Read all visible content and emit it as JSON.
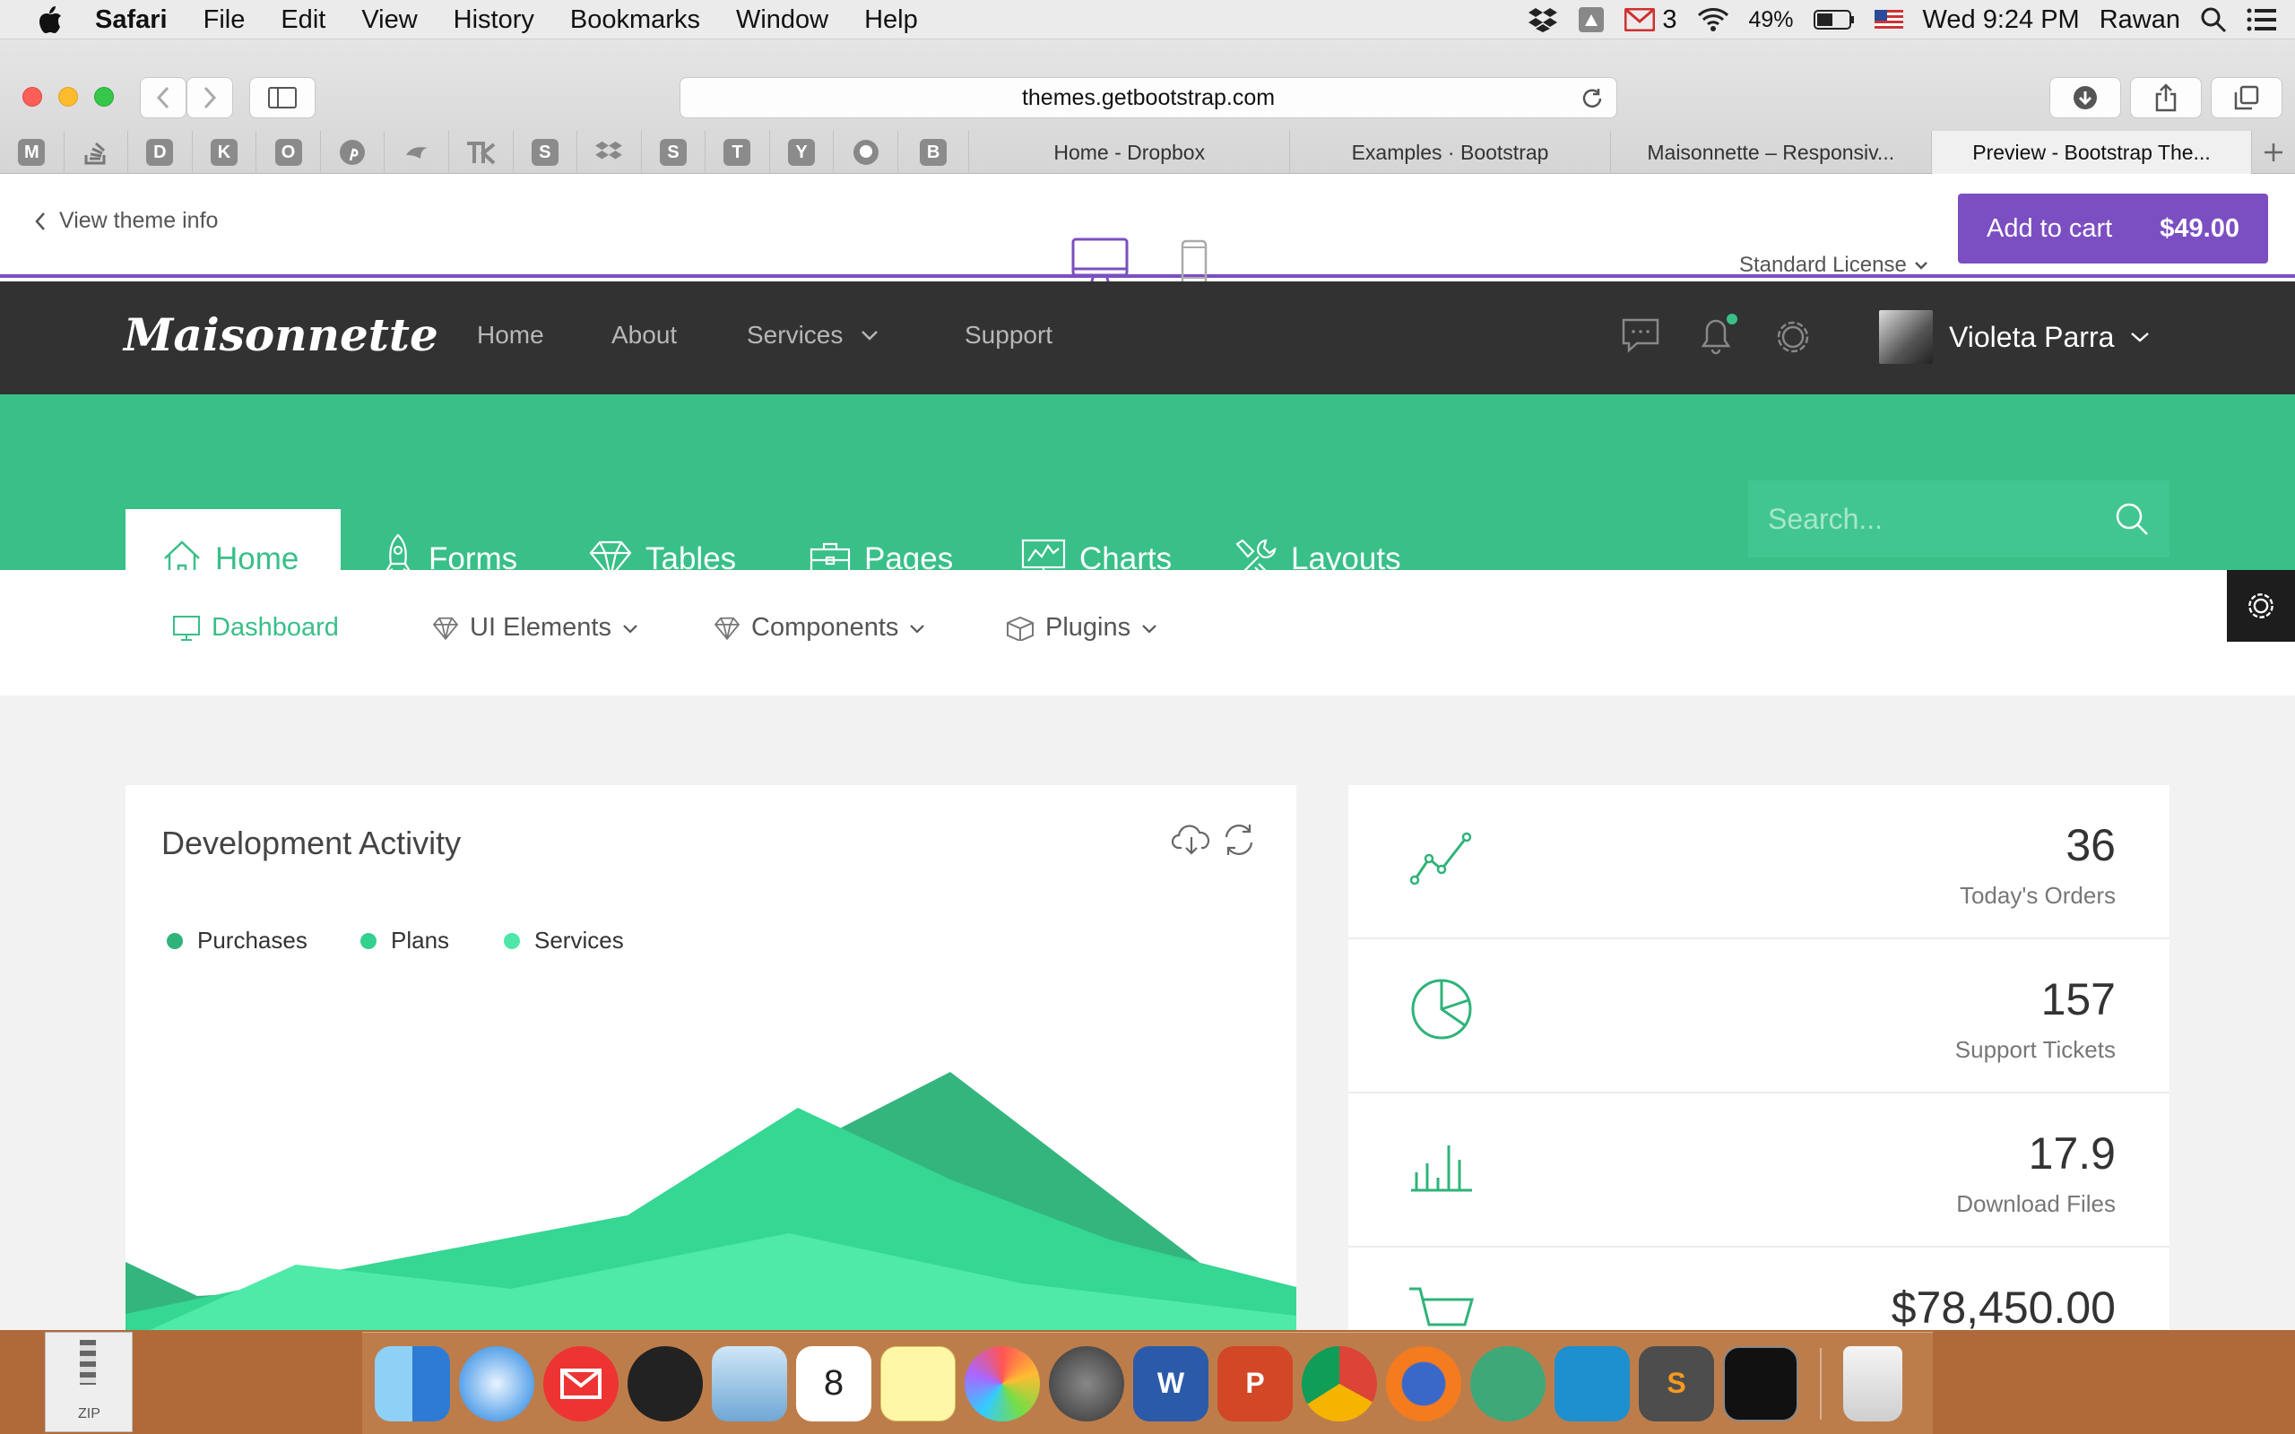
{
  "menubar": {
    "app_name": "Safari",
    "items": [
      "File",
      "Edit",
      "View",
      "History",
      "Bookmarks",
      "Window",
      "Help"
    ],
    "mail_count": "3",
    "battery": "49%",
    "clock": "Wed 9:24 PM",
    "user": "Rawan"
  },
  "browser": {
    "url": "themes.getbootstrap.com",
    "bookmarks": [
      "M",
      "",
      "D",
      "K",
      "O",
      "",
      "",
      "",
      "S",
      "",
      "S",
      "T",
      "Y",
      "",
      "B"
    ],
    "tabs": [
      "Home - Dropbox",
      "Examples · Bootstrap",
      "Maisonnette – Responsiv...",
      "Preview - Bootstrap The..."
    ]
  },
  "preview": {
    "view_theme": "View theme info",
    "license": "Standard License",
    "add_to_cart": "Add to cart",
    "price": "$49.00"
  },
  "app": {
    "brand": "Maisonnette",
    "nav": [
      "Home",
      "About",
      "Services",
      "Support"
    ],
    "user_name": "Violeta Parra",
    "tabs": [
      "Home",
      "Forms",
      "Tables",
      "Pages",
      "Charts",
      "Layouts"
    ],
    "search_placeholder": "Search...",
    "subnav": [
      "Dashboard",
      "UI Elements",
      "Components",
      "Plugins"
    ]
  },
  "activity": {
    "title": "Development Activity",
    "legend": [
      {
        "name": "Purchases",
        "color": "#2fb37a"
      },
      {
        "name": "Plans",
        "color": "#33d08e"
      },
      {
        "name": "Services",
        "color": "#4ee7a9"
      }
    ]
  },
  "stats": [
    {
      "value": "36",
      "label": "Today's Orders",
      "icon": "line-chart-icon"
    },
    {
      "value": "157",
      "label": "Support Tickets",
      "icon": "pie-chart-icon"
    },
    {
      "value": "17.9",
      "label": "Download Files",
      "icon": "bar-chart-icon"
    },
    {
      "value": "$78,450.00",
      "label": "",
      "icon": "cart-icon"
    }
  ],
  "colors": {
    "accent_green": "#39bf88",
    "purple": "#7b4fc2",
    "dark_nav": "#323233"
  }
}
